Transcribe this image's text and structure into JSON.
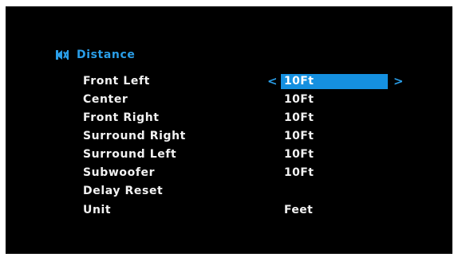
{
  "menu": {
    "title": "Distance",
    "icon": "speaker-setup-icon",
    "accent_color": "#2a9ee8",
    "selection_color": "#1590e0"
  },
  "selector": {
    "left_arrow": "<",
    "right_arrow": ">"
  },
  "rows": [
    {
      "label": "Front Left",
      "value": "10Ft",
      "selected": true
    },
    {
      "label": "Center",
      "value": "10Ft"
    },
    {
      "label": "Front Right",
      "value": "10Ft"
    },
    {
      "label": "Surround Right",
      "value": "10Ft"
    },
    {
      "label": "Surround Left",
      "value": "10Ft"
    },
    {
      "label": "Subwoofer",
      "value": "10Ft"
    },
    {
      "label": "Delay Reset",
      "value": ""
    },
    {
      "label": "Unit",
      "value": "Feet"
    }
  ]
}
